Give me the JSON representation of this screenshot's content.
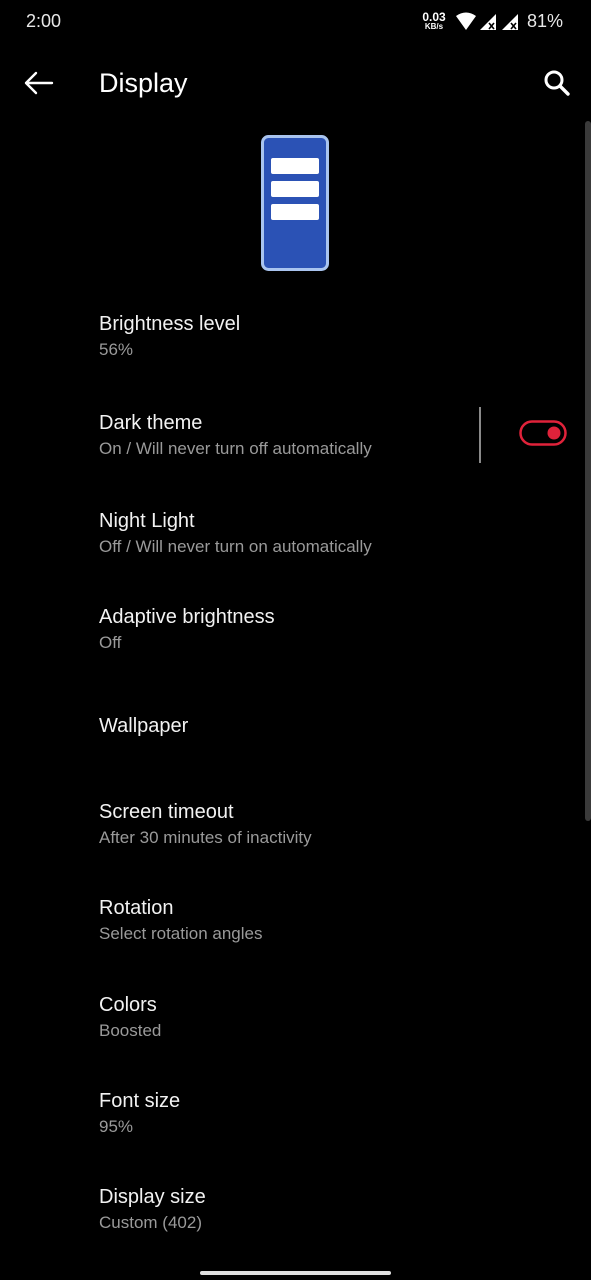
{
  "status_bar": {
    "time": "2:00",
    "net_speed_value": "0.03",
    "net_speed_unit": "KB/s",
    "battery": "81%",
    "icons": [
      "wifi-icon",
      "signal-icon",
      "signal-icon"
    ]
  },
  "app_bar": {
    "title": "Display",
    "back_icon": "arrow-left-icon",
    "search_icon": "search-icon"
  },
  "settings": [
    {
      "title": "Brightness level",
      "subtitle": "56%"
    },
    {
      "title": "Dark theme",
      "subtitle": "On / Will never turn off automatically",
      "toggle_on": true
    },
    {
      "title": "Night Light",
      "subtitle": "Off / Will never turn on automatically"
    },
    {
      "title": "Adaptive brightness",
      "subtitle": "Off"
    },
    {
      "title": "Wallpaper"
    },
    {
      "title": "Screen timeout",
      "subtitle": "After 30 minutes of inactivity"
    },
    {
      "title": "Rotation",
      "subtitle": "Select rotation angles"
    },
    {
      "title": "Colors",
      "subtitle": "Boosted"
    },
    {
      "title": "Font size",
      "subtitle": "95%"
    },
    {
      "title": "Display size",
      "subtitle": "Custom (402)"
    }
  ],
  "colors": {
    "background": "#000000",
    "accent": "#e0223a",
    "hero_blue": "#2b52b5",
    "hero_border": "#a9c4ef"
  }
}
